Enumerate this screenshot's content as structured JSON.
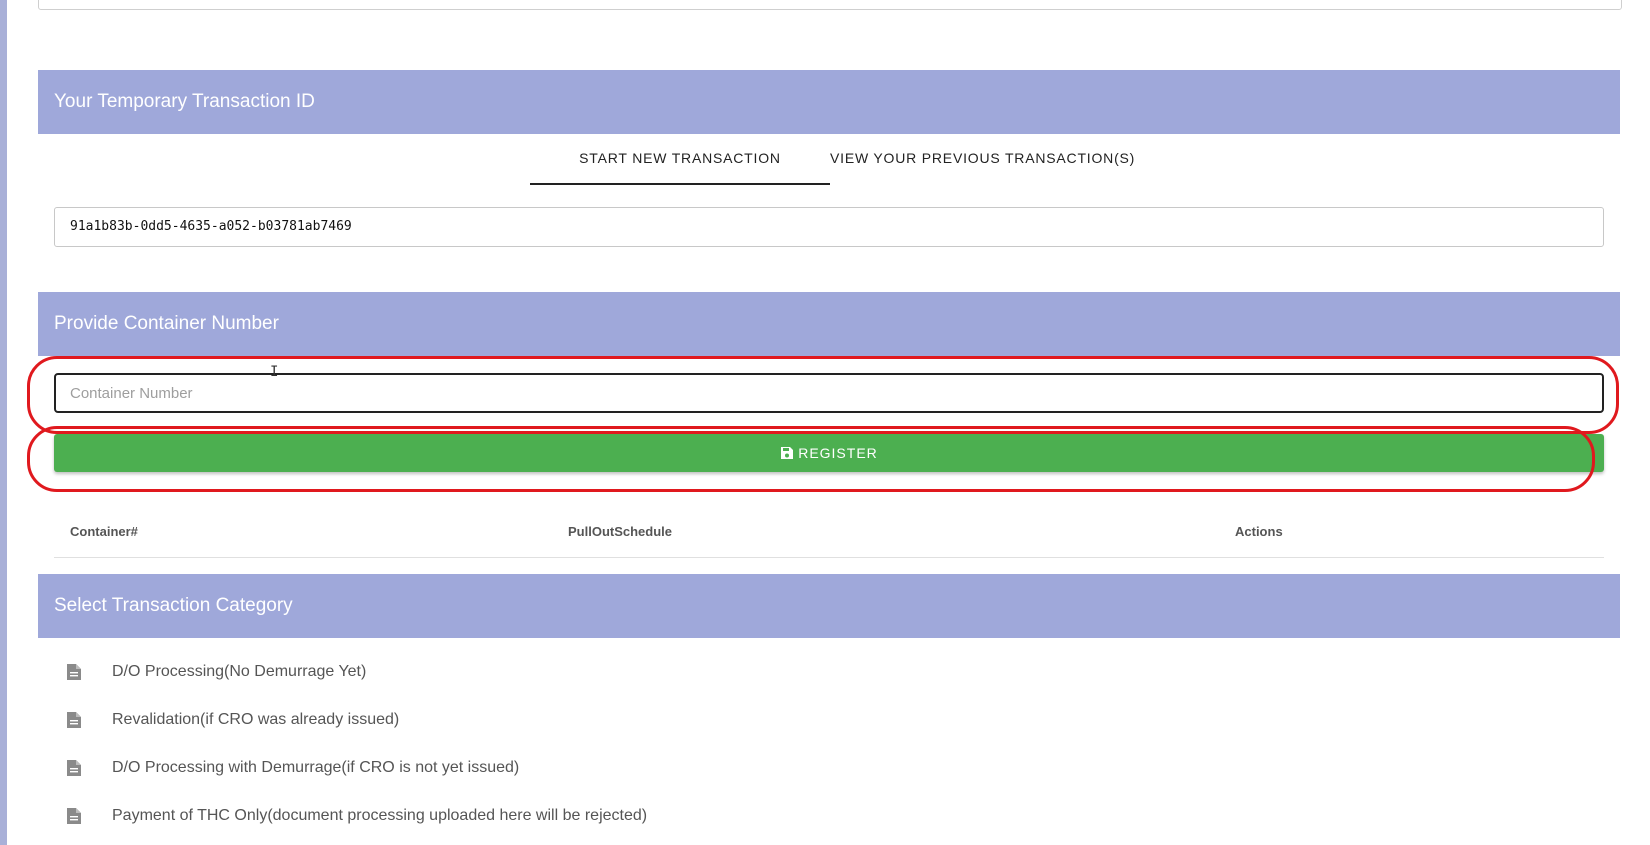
{
  "transaction_section": {
    "header": "Your Temporary Transaction ID",
    "tabs": [
      {
        "label": "START NEW TRANSACTION",
        "active": true
      },
      {
        "label": "VIEW YOUR PREVIOUS TRANSACTION(S)",
        "active": false
      }
    ],
    "transaction_id": "91a1b83b-0dd5-4635-a052-b03781ab7469"
  },
  "container_section": {
    "header": "Provide Container Number",
    "input_value": "",
    "input_placeholder": "Container Number",
    "register_label": "REGISTER",
    "register_icon": "save-icon",
    "table_headers": [
      "Container#",
      "PullOutSchedule",
      "Actions"
    ]
  },
  "category_section": {
    "header": "Select Transaction Category",
    "items": [
      {
        "label": "D/O Processing(No Demurrage Yet)",
        "icon": "document-icon"
      },
      {
        "label": "Revalidation(if CRO was already issued)",
        "icon": "document-icon"
      },
      {
        "label": "D/O Processing with Demurrage(if CRO is not yet issued)",
        "icon": "document-icon"
      },
      {
        "label": "Payment of THC Only(document processing uploaded here will be rejected)",
        "icon": "document-icon"
      }
    ]
  },
  "colors": {
    "header_bg": "#9fa8da",
    "register_bg": "#4caf50",
    "annotation": "#e0191e"
  }
}
